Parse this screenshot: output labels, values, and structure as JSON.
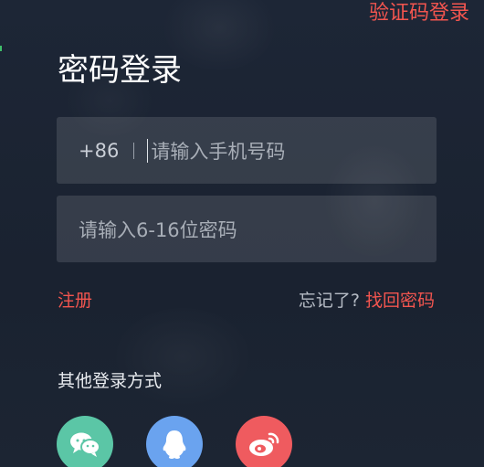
{
  "header": {
    "sms_login_label": "验证码登录"
  },
  "title": "密码登录",
  "phone": {
    "prefix": "+86",
    "placeholder": "请输入手机号码"
  },
  "password": {
    "placeholder": "请输入6-16位密码"
  },
  "links": {
    "register": "注册",
    "forgot_question": "忘记了?",
    "forgot_action": "找回密码"
  },
  "other_login": {
    "label": "其他登录方式",
    "methods": [
      {
        "icon": "wechat-icon",
        "color": "#5bc6a6"
      },
      {
        "icon": "qq-icon",
        "color": "#6aa3ef"
      },
      {
        "icon": "weibo-icon",
        "color": "#ef5b5f"
      }
    ]
  },
  "colors": {
    "accent": "#f2554f",
    "background": "#1b2433"
  }
}
